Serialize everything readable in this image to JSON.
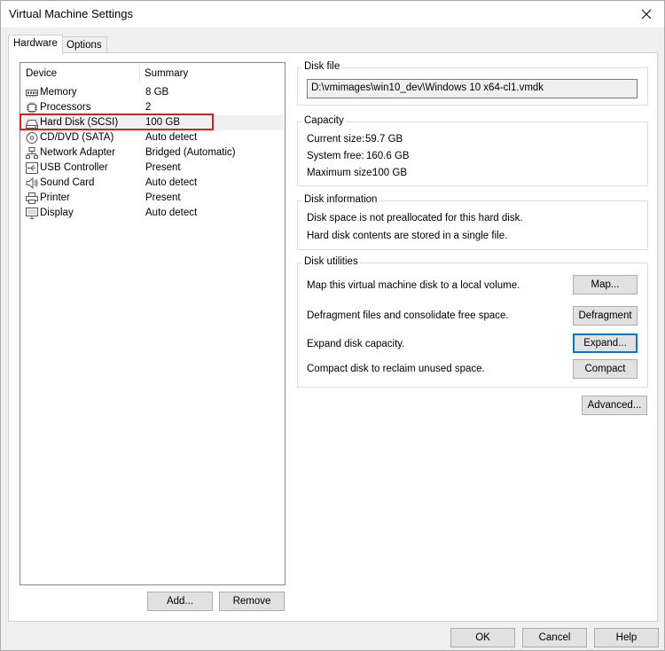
{
  "window": {
    "title": "Virtual Machine Settings"
  },
  "tabs": [
    {
      "label": "Hardware",
      "active": true
    },
    {
      "label": "Options",
      "active": false
    }
  ],
  "device_list": {
    "columns": {
      "device": "Device",
      "summary": "Summary"
    },
    "items": [
      {
        "name": "Memory",
        "summary": "8 GB",
        "icon": "memory-icon"
      },
      {
        "name": "Processors",
        "summary": "2",
        "icon": "processor-icon"
      },
      {
        "name": "Hard Disk (SCSI)",
        "summary": "100 GB",
        "icon": "hard-disk-icon",
        "selected": true
      },
      {
        "name": "CD/DVD (SATA)",
        "summary": "Auto detect",
        "icon": "cd-dvd-icon"
      },
      {
        "name": "Network Adapter",
        "summary": "Bridged (Automatic)",
        "icon": "network-adapter-icon"
      },
      {
        "name": "USB Controller",
        "summary": "Present",
        "icon": "usb-controller-icon"
      },
      {
        "name": "Sound Card",
        "summary": "Auto detect",
        "icon": "sound-card-icon"
      },
      {
        "name": "Printer",
        "summary": "Present",
        "icon": "printer-icon"
      },
      {
        "name": "Display",
        "summary": "Auto detect",
        "icon": "display-icon"
      }
    ],
    "add_button": "Add...",
    "remove_button": "Remove"
  },
  "disk_file": {
    "label": "Disk file",
    "path": "D:\\vmimages\\win10_dev\\Windows 10 x64-cl1.vmdk"
  },
  "capacity": {
    "label": "Capacity",
    "current_label": "Current size:",
    "current_value": "59.7 GB",
    "free_label": "System free:",
    "free_value": "160.6 GB",
    "max_label": "Maximum size:",
    "max_value": "100 GB"
  },
  "disk_info": {
    "label": "Disk information",
    "line1": "Disk space is not preallocated for this hard disk.",
    "line2": "Hard disk contents are stored in a single file."
  },
  "disk_utilities": {
    "label": "Disk utilities",
    "map_text": "Map this virtual machine disk to a local volume.",
    "map_button": "Map...",
    "defrag_text": "Defragment files and consolidate free space.",
    "defrag_button": "Defragment",
    "expand_text": "Expand disk capacity.",
    "expand_button": "Expand...",
    "compact_text": "Compact disk to reclaim unused space.",
    "compact_button": "Compact"
  },
  "advanced_button": "Advanced...",
  "footer": {
    "ok": "OK",
    "cancel": "Cancel",
    "help": "Help"
  },
  "colors": {
    "selection_outline": "#e01d1d",
    "focus_border": "#0078d7"
  }
}
